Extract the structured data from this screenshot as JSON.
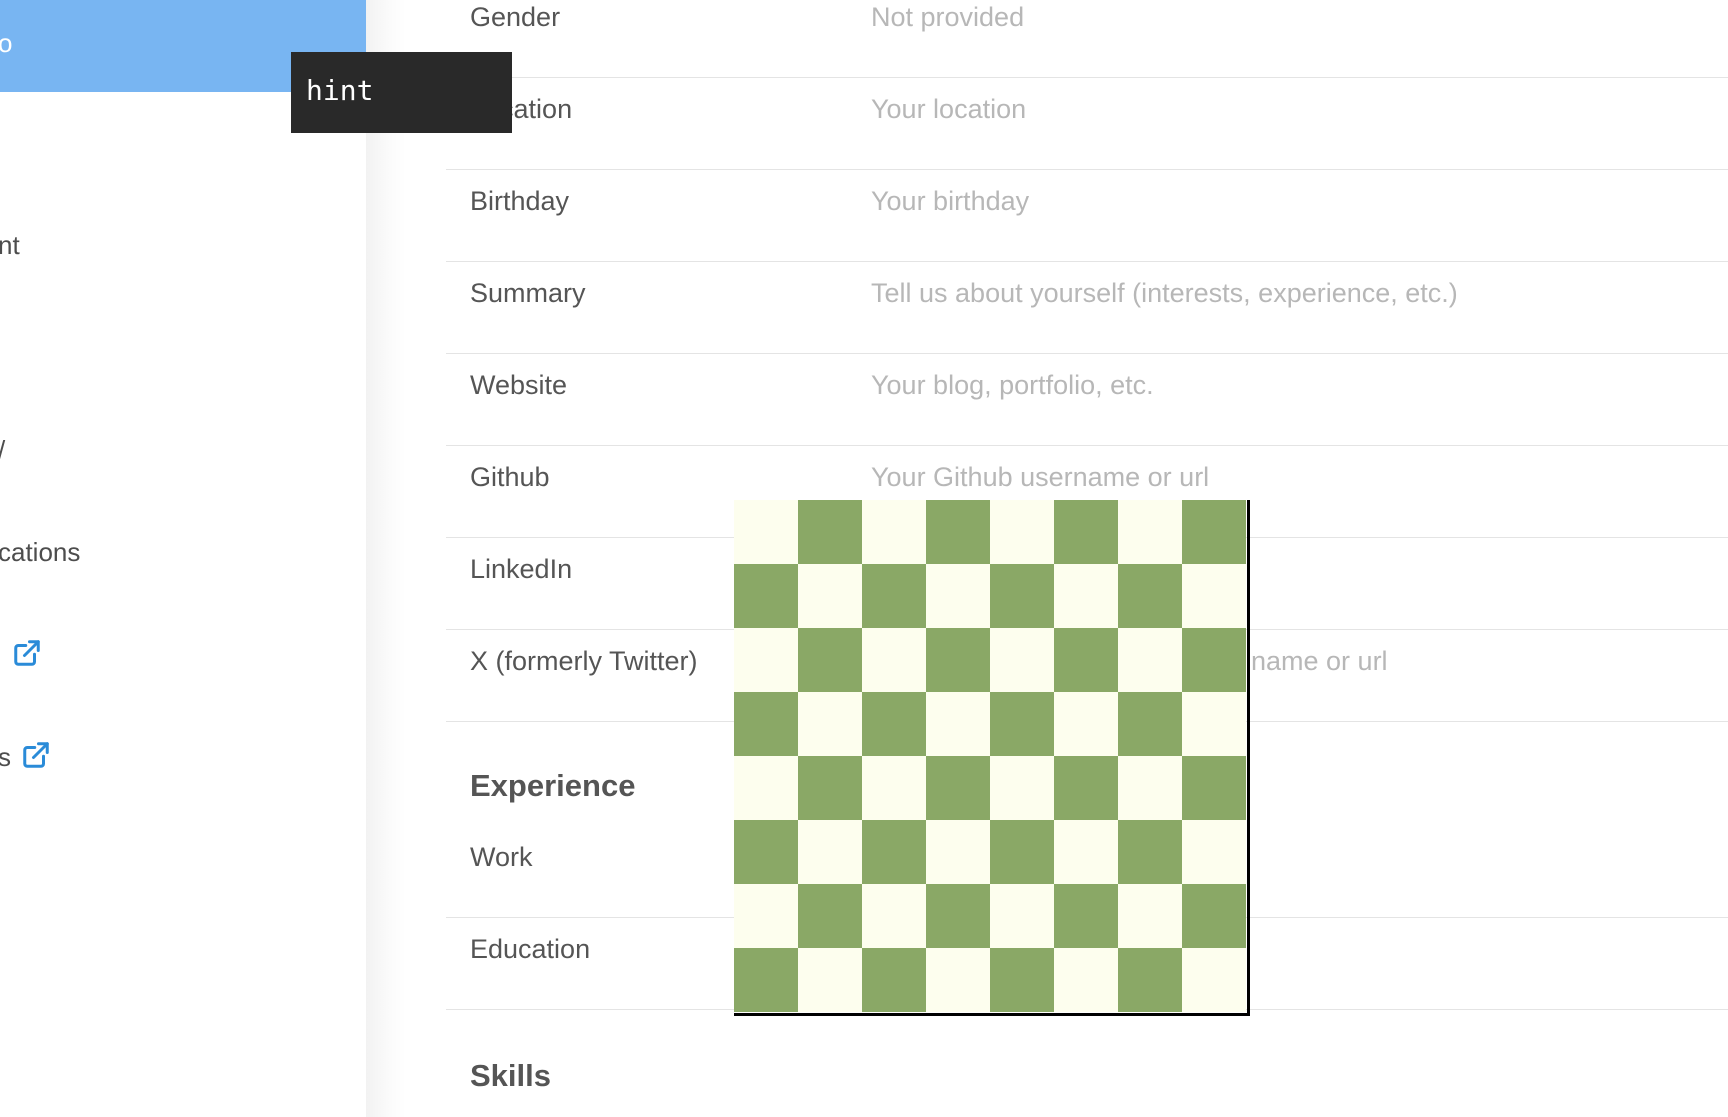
{
  "sidebar": {
    "active_item": "o",
    "items": [
      {
        "label": "nt"
      },
      {
        "label": "/"
      },
      {
        "label": "cations"
      },
      {
        "label": "",
        "external": true
      },
      {
        "label": "s",
        "external": true
      }
    ],
    "tooltip": "hint"
  },
  "profile": {
    "rows": [
      {
        "label": "Gender",
        "value": "Not provided"
      },
      {
        "label": "Location",
        "value": "Your location"
      },
      {
        "label": "Birthday",
        "value": "Your birthday"
      },
      {
        "label": "Summary",
        "value": "Tell us about yourself (interests, experience, etc.)"
      },
      {
        "label": "Website",
        "value": "Your blog, portfolio, etc."
      },
      {
        "label": "Github",
        "value": "Your Github username or url"
      },
      {
        "label": "LinkedIn",
        "value": ""
      },
      {
        "label": "X (formerly Twitter)",
        "value": "name or url"
      }
    ],
    "experience_title": "Experience",
    "experience_rows": [
      {
        "label": "Work"
      },
      {
        "label": "Education"
      }
    ],
    "skills_title": "Skills"
  },
  "board": {
    "light_color": "#fdfeee",
    "dark_color": "#8aa866",
    "size": 8
  },
  "icons": {
    "external": "external-link-icon"
  },
  "colors": {
    "accent": "#78b5f2",
    "link": "#2a8bd8"
  }
}
